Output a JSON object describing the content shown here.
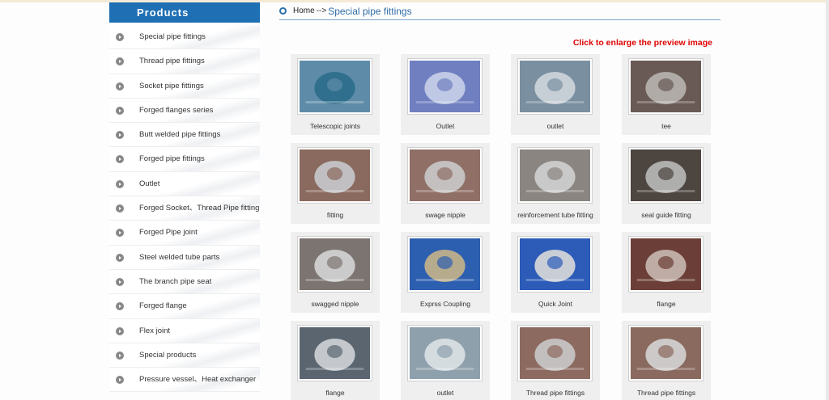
{
  "sidebar": {
    "header": "Products",
    "items": [
      {
        "label": "Special pipe fittings"
      },
      {
        "label": "Thread pipe fittings"
      },
      {
        "label": "Socket pipe fittings"
      },
      {
        "label": "Forged flanges series"
      },
      {
        "label": "Butt welded pipe fittings"
      },
      {
        "label": "Forged pipe fittings"
      },
      {
        "label": "Outlet"
      },
      {
        "label": "Forged Socket、Thread Pipe fitting"
      },
      {
        "label": "Forged Pipe joint"
      },
      {
        "label": "Steel welded tube parts"
      },
      {
        "label": "The branch pipe seat"
      },
      {
        "label": "Forged flange"
      },
      {
        "label": "Flex joint"
      },
      {
        "label": "Special products"
      },
      {
        "label": "Pressure vessel、Heat exchanger"
      }
    ]
  },
  "breadcrumb": {
    "home": "Home",
    "separator": "-->",
    "current": "Special pipe fittings"
  },
  "notice": "Click to enlarge the preview image",
  "products": [
    {
      "caption": "Telescopic joints",
      "icon": "telescopic-joint-photo",
      "bg": "#5e8ca8",
      "fg": "#2b6b8a"
    },
    {
      "caption": "Outlet",
      "icon": "outlet-photo",
      "bg": "#6f7fc0",
      "fg": "#c8d0e8"
    },
    {
      "caption": "outlet",
      "icon": "outlet-photo",
      "bg": "#7a8fa0",
      "fg": "#cfd6dc"
    },
    {
      "caption": "tee",
      "icon": "tee-photo",
      "bg": "#6a5a55",
      "fg": "#b8b4b0"
    },
    {
      "caption": "fitting",
      "icon": "fitting-photo",
      "bg": "#8a6a5e",
      "fg": "#c7c9cc"
    },
    {
      "caption": "swage nipple",
      "icon": "swage-nipple-photo",
      "bg": "#8f6f66",
      "fg": "#c9c9c9"
    },
    {
      "caption": "reinforcement tube fitting",
      "icon": "reinforcement-tube-photo",
      "bg": "#8a8580",
      "fg": "#d0d0d0"
    },
    {
      "caption": "seal guide fitting",
      "icon": "seal-guide-photo",
      "bg": "#4d4540",
      "fg": "#b9b9b9"
    },
    {
      "caption": "swagged nipple",
      "icon": "swagged-nipple-photo",
      "bg": "#7c7470",
      "fg": "#d5d5d5"
    },
    {
      "caption": "Exprss Coupling",
      "icon": "coupling-photo",
      "bg": "#2d5fb0",
      "fg": "#c7b48a"
    },
    {
      "caption": "Quick Joint",
      "icon": "quick-joint-photo",
      "bg": "#2c5bb8",
      "fg": "#d9d9d9"
    },
    {
      "caption": "flange",
      "icon": "flange-photo",
      "bg": "#6b3f38",
      "fg": "#c9b8b0"
    },
    {
      "caption": "flange",
      "icon": "flange-photo",
      "bg": "#5a6570",
      "fg": "#cfd3d6"
    },
    {
      "caption": "outlet",
      "icon": "outlet-photo",
      "bg": "#8fa0ad",
      "fg": "#dce2e6"
    },
    {
      "caption": "Thread pipe fittings",
      "icon": "thread-fitting-photo",
      "bg": "#8d6a60",
      "fg": "#c9c9c9"
    },
    {
      "caption": "Thread pipe fittings",
      "icon": "thread-fitting-photo",
      "bg": "#8a6a5e",
      "fg": "#d4d4d4"
    }
  ]
}
